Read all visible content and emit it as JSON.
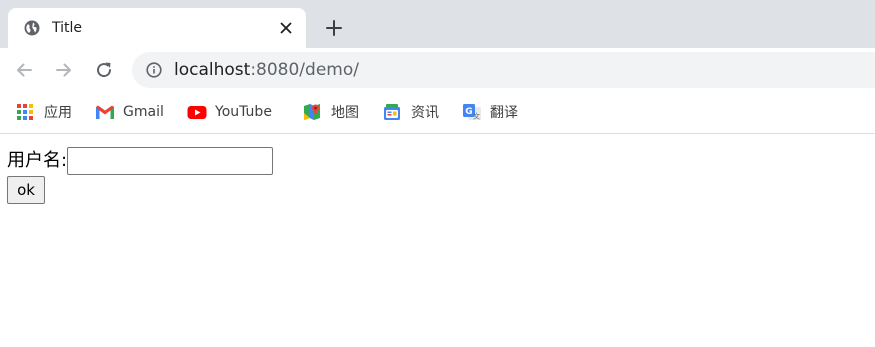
{
  "browser": {
    "tab": {
      "title": "Title",
      "favicon": "globe-icon",
      "close_icon": "close-icon"
    },
    "new_tab_icon": "plus-icon",
    "nav": {
      "back_icon": "arrow-left-icon",
      "forward_icon": "arrow-right-icon",
      "reload_icon": "reload-icon"
    },
    "omnibox": {
      "info_icon": "info-icon",
      "url_host": "localhost",
      "url_rest": ":8080/demo/"
    },
    "bookmarks": [
      {
        "label": "应用",
        "icon": "apps-grid-icon"
      },
      {
        "label": "Gmail",
        "icon": "gmail-icon"
      },
      {
        "label": "YouTube",
        "icon": "youtube-icon"
      },
      {
        "label": "地图",
        "icon": "maps-icon"
      },
      {
        "label": "资讯",
        "icon": "news-icon"
      },
      {
        "label": "翻译",
        "icon": "translate-icon"
      }
    ]
  },
  "page": {
    "form": {
      "username_label": "用户名:",
      "username_value": "",
      "submit_label": "ok"
    }
  },
  "colors": {
    "tabstrip_bg": "#dee1e6",
    "omnibox_bg": "#f1f3f4",
    "text_primary": "#202124",
    "text_secondary": "#5f6368"
  }
}
